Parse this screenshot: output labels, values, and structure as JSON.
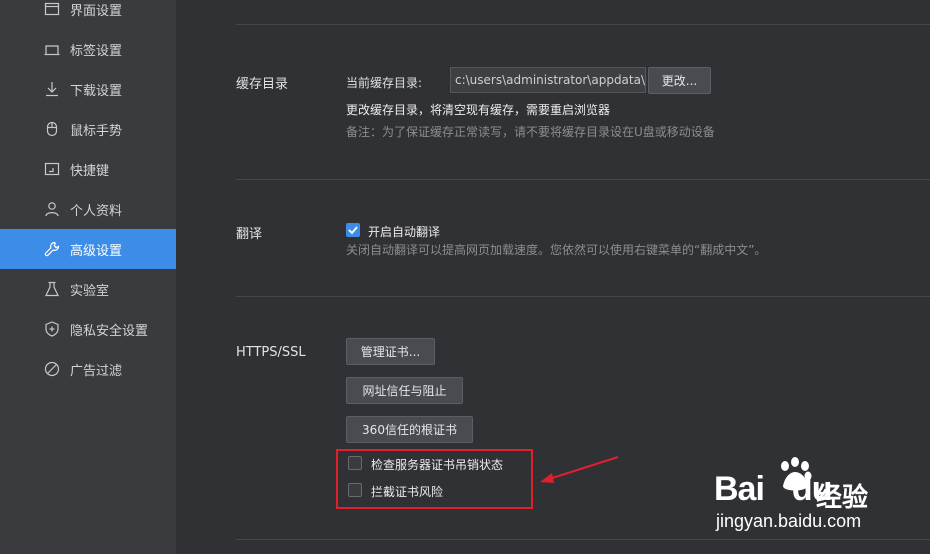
{
  "sidebar": {
    "items": [
      {
        "label": "界面设置",
        "icon": "window-icon"
      },
      {
        "label": "标签设置",
        "icon": "tab-icon"
      },
      {
        "label": "下载设置",
        "icon": "download-icon"
      },
      {
        "label": "鼠标手势",
        "icon": "mouse-icon"
      },
      {
        "label": "快捷键",
        "icon": "keyboard-icon"
      },
      {
        "label": "个人资料",
        "icon": "user-icon"
      },
      {
        "label": "高级设置",
        "icon": "wrench-icon",
        "active": true
      },
      {
        "label": "实验室",
        "icon": "flask-icon"
      },
      {
        "label": "隐私安全设置",
        "icon": "shield-icon"
      },
      {
        "label": "广告过滤",
        "icon": "block-icon"
      }
    ]
  },
  "cache": {
    "section_label": "缓存目录",
    "current_label": "当前缓存目录:",
    "path_value": "c:\\users\\administrator\\appdata\\l",
    "change_button": "更改...",
    "notice": "更改缓存目录，将清空现有缓存，需要重启浏览器",
    "note": "备注：为了保证缓存正常读写，请不要将缓存目录设在U盘或移动设备"
  },
  "translate": {
    "section_label": "翻译",
    "checkbox_label": "开启自动翻译",
    "checked": true,
    "description": "关闭自动翻译可以提高网页加载速度。您依然可以使用右键菜单的“翻成中文”。"
  },
  "https": {
    "section_label": "HTTPS/SSL",
    "buttons": [
      "管理证书...",
      "网址信任与阻止",
      "360信任的根证书"
    ],
    "checkboxes": [
      {
        "label": "检查服务器证书吊销状态",
        "checked": false
      },
      {
        "label": "拦截证书风险",
        "checked": false
      }
    ]
  },
  "watermark": {
    "brand": "Bai",
    "brand2": "du",
    "suffix": "经验",
    "url": "jingyan.baidu.com"
  },
  "colors": {
    "accent": "#3d8ce8",
    "highlight": "#e0202a"
  }
}
